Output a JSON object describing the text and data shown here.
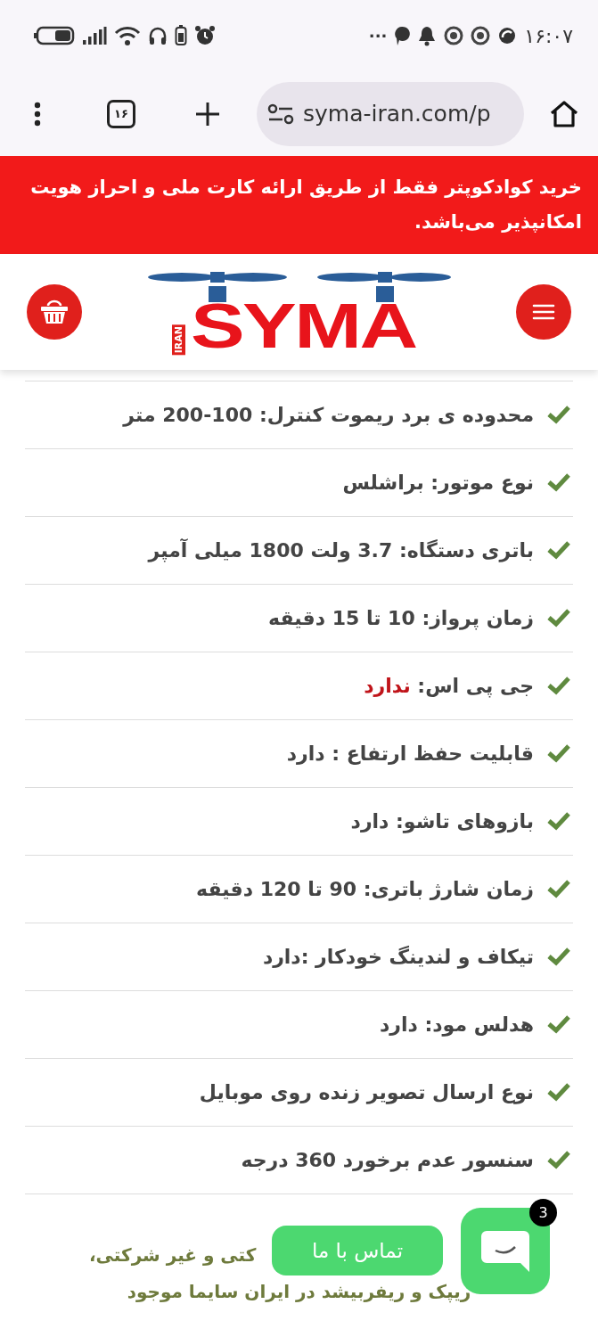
{
  "status_bar": {
    "time": "۱۶:۰۷",
    "overflow": "···"
  },
  "browser": {
    "tab_count": "۱۶",
    "url": "syma-iran.com/p"
  },
  "banner": {
    "text": "خرید کوادکوپتر فقط از طریق ارائه کارت ملی و احراز هویت امکانپذیر می‌باشد."
  },
  "header": {
    "logo_word": "SYMA",
    "logo_tag": "IRAN"
  },
  "specs": [
    {
      "text": "محدوده ی برد ریموت کنترل: 100-200 متر"
    },
    {
      "text": "نوع موتور: براشلس"
    },
    {
      "text": "باتری دستگاه: 3.7 ولت 1800 میلی آمپر"
    },
    {
      "text": "زمان پرواز: 10 تا 15 دقیقه"
    },
    {
      "text": "جی پی اس: ",
      "highlight": "ندارد"
    },
    {
      "text": "قابلیت حفظ ارتفاع : دارد"
    },
    {
      "text": "بازوهای تاشو: دارد"
    },
    {
      "text": "زمان شارژ باتری: 90 تا 120 دقیقه"
    },
    {
      "text": "تیکاف و لندینگ خودکار :دارد"
    },
    {
      "text": "هدلس مود: دارد"
    },
    {
      "text": "نوع ارسال تصویر زنده روی موبایل"
    },
    {
      "text": "سنسور عدم برخورد 360 درجه"
    }
  ],
  "paragraph": {
    "lines": [
      "کتی و غیر شرکتی،",
      "ریپک و ریفربیشد در ایران سایما موجود"
    ]
  },
  "chat": {
    "label": "تماس با ما",
    "badge": "3"
  }
}
